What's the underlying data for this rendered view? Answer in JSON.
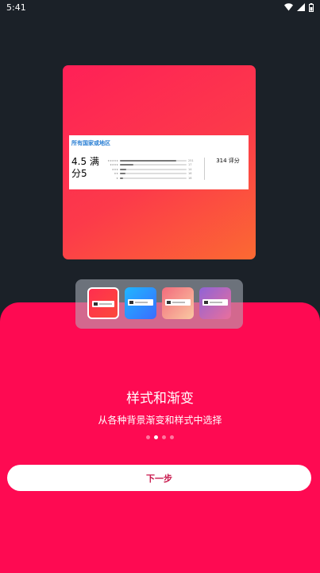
{
  "status_bar": {
    "time": "5:41",
    "icons": [
      "wifi-icon",
      "signal-icon",
      "battery-icon"
    ]
  },
  "preview": {
    "widget": {
      "title": "所有国家或地区",
      "score_label": "4.5 满分5",
      "bars": [
        {
          "label": "★★★★★",
          "value": 0.84,
          "count": "251"
        },
        {
          "label": "★★★★",
          "value": 0.2,
          "count": "17"
        },
        {
          "label": "★★★",
          "value": 0.1,
          "count": "14"
        },
        {
          "label": "★★",
          "value": 0.08,
          "count": "16"
        },
        {
          "label": "★",
          "value": 0.05,
          "count": "16"
        }
      ],
      "total_label": "314 评分"
    }
  },
  "style_picker": {
    "thumbnails": [
      {
        "name": "thumb-red-gradient",
        "gradient": [
          "#ff2e4f",
          "#fc4a3c"
        ],
        "selected": true
      },
      {
        "name": "thumb-blue-gradient",
        "gradient": [
          "#1fb6ff",
          "#3a6dff"
        ],
        "selected": false
      },
      {
        "name": "thumb-peach-gradient",
        "gradient": [
          "#f36b7c",
          "#f9c9a2"
        ],
        "selected": false
      },
      {
        "name": "thumb-purple-gradient",
        "gradient": [
          "#8f63d6",
          "#ea6f9c"
        ],
        "selected": false
      }
    ]
  },
  "onboarding": {
    "title": "样式和渐变",
    "subtitle": "从各种背景渐变和样式中选择",
    "page_count": 4,
    "active_page": 2,
    "next_label": "下一步"
  },
  "colors": {
    "background": "#1b2128",
    "accent": "#fe0a52",
    "button_text": "#c8184c"
  }
}
